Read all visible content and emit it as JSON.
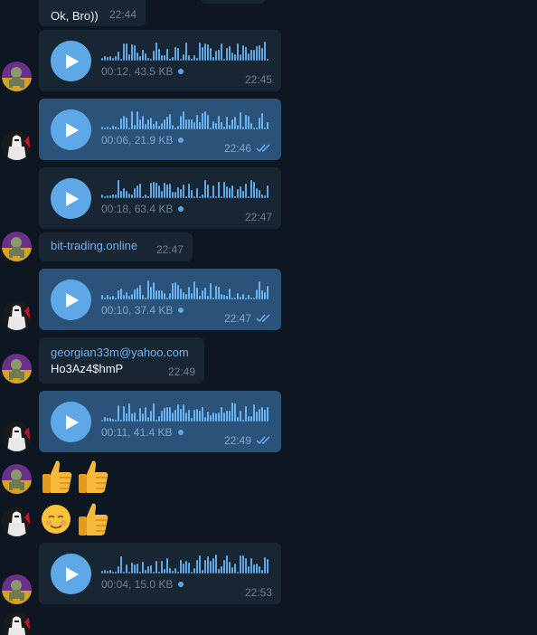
{
  "messages": [
    {
      "type": "text",
      "text": "Ok, Bro))",
      "time": "22:44"
    },
    {
      "type": "voice",
      "meta": "00:12, 43.5 KB",
      "time": "22:45"
    },
    {
      "type": "voice",
      "meta": "00:06, 21.9 KB",
      "time": "22:46",
      "read": true
    },
    {
      "type": "voice",
      "meta": "00:18, 63.4 KB",
      "time": "22:47"
    },
    {
      "type": "link",
      "text": "bit-trading.online",
      "time": "22:47"
    },
    {
      "type": "voice",
      "meta": "00:10, 37.4 KB",
      "time": "22:47",
      "read": true
    },
    {
      "type": "text2",
      "line1": "georgian33m@yahoo.com",
      "line2": "Ho3Az4$hmP",
      "time": "22:49"
    },
    {
      "type": "voice",
      "meta": "00:11, 41.4 KB",
      "time": "22:49",
      "read": true
    },
    {
      "type": "voice",
      "meta": "00:04, 15.0 KB",
      "time": "22:53"
    }
  ],
  "emoji_rows": [
    [
      "thumbs-up",
      "thumbs-up"
    ],
    [
      "smiling-face",
      "thumbs-up"
    ]
  ],
  "colors": {
    "background": "#0e1621",
    "incoming_bubble": "#182533",
    "outgoing_bubble": "#2b5278",
    "accent": "#5fa8e8",
    "link": "#6ab3f3"
  },
  "icons": {
    "play": "play-icon",
    "read_receipt": "double-check-icon",
    "unplayed": "unplayed-dot-icon"
  }
}
